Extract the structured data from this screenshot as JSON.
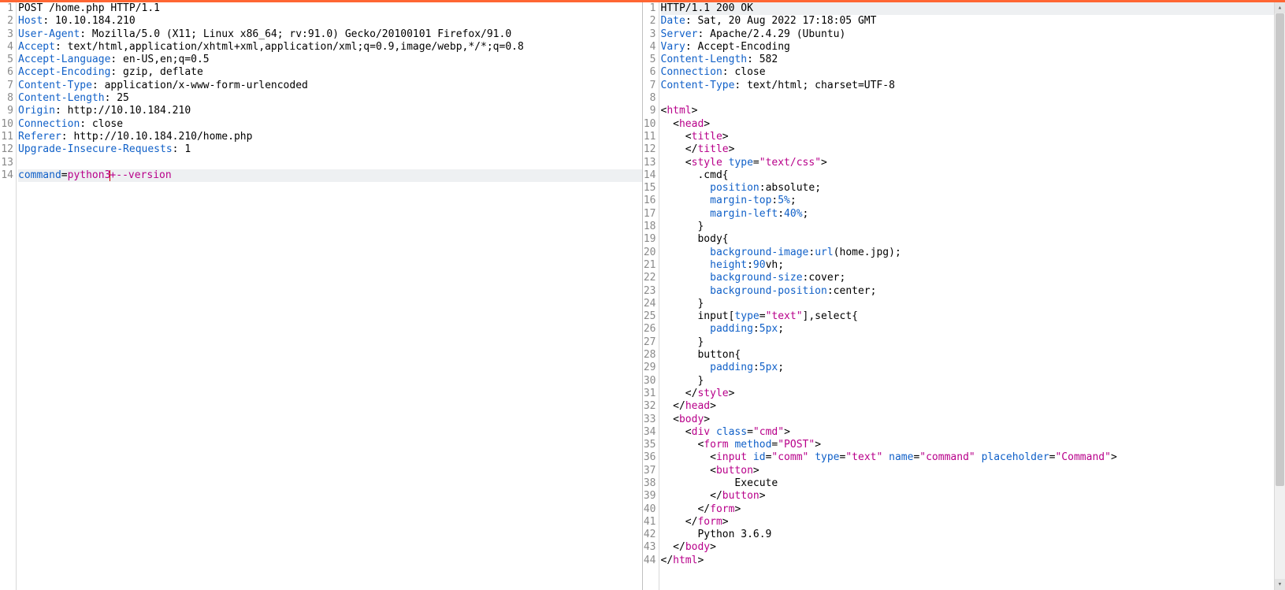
{
  "request": {
    "lines": [
      [
        {
          "t": "POST /home.php HTTP/1.1"
        }
      ],
      [
        {
          "t": "Host",
          "c": "hdr"
        },
        {
          "t": ": 10.10.184.210"
        }
      ],
      [
        {
          "t": "User-Agent",
          "c": "hdr"
        },
        {
          "t": ": Mozilla/5.0 (X11; Linux x86_64; rv:91.0) Gecko/20100101 Firefox/91.0"
        }
      ],
      [
        {
          "t": "Accept",
          "c": "hdr"
        },
        {
          "t": ": text/html,application/xhtml+xml,application/xml;q=0.9,image/webp,*/*;q=0.8"
        }
      ],
      [
        {
          "t": "Accept-Language",
          "c": "hdr"
        },
        {
          "t": ": en-US,en;q=0.5"
        }
      ],
      [
        {
          "t": "Accept-Encoding",
          "c": "hdr"
        },
        {
          "t": ": gzip, deflate"
        }
      ],
      [
        {
          "t": "Content-Type",
          "c": "hdr"
        },
        {
          "t": ": application/x-www-form-urlencoded"
        }
      ],
      [
        {
          "t": "Content-Length",
          "c": "hdr"
        },
        {
          "t": ": 25"
        }
      ],
      [
        {
          "t": "Origin",
          "c": "hdr"
        },
        {
          "t": ": http://10.10.184.210"
        }
      ],
      [
        {
          "t": "Connection",
          "c": "hdr"
        },
        {
          "t": ": close"
        }
      ],
      [
        {
          "t": "Referer",
          "c": "hdr"
        },
        {
          "t": ": http://10.10.184.210/home.php"
        }
      ],
      [
        {
          "t": "Upgrade-Insecure-Requests",
          "c": "hdr"
        },
        {
          "t": ": 1"
        }
      ],
      [
        {
          "t": ""
        }
      ],
      [
        {
          "t": "command",
          "c": "attr"
        },
        {
          "t": "="
        },
        {
          "t": "python3",
          "c": "val"
        },
        {
          "caret": true
        },
        {
          "t": "+--version",
          "c": "val"
        }
      ]
    ],
    "current_line": 14
  },
  "response": {
    "lines": [
      [
        {
          "t": "HTTP/1.1 200 OK"
        }
      ],
      [
        {
          "t": "Date",
          "c": "hdr"
        },
        {
          "t": ": Sat, 20 Aug 2022 17:18:05 GMT"
        }
      ],
      [
        {
          "t": "Server",
          "c": "hdr"
        },
        {
          "t": ": Apache/2.4.29 (Ubuntu)"
        }
      ],
      [
        {
          "t": "Vary",
          "c": "hdr"
        },
        {
          "t": ": Accept-Encoding"
        }
      ],
      [
        {
          "t": "Content-Length",
          "c": "hdr"
        },
        {
          "t": ": 582"
        }
      ],
      [
        {
          "t": "Connection",
          "c": "hdr"
        },
        {
          "t": ": close"
        }
      ],
      [
        {
          "t": "Content-Type",
          "c": "hdr"
        },
        {
          "t": ": text/html; charset=UTF-8"
        }
      ],
      [
        {
          "t": ""
        }
      ],
      [
        {
          "t": "<"
        },
        {
          "t": "html",
          "c": "tag"
        },
        {
          "t": ">"
        }
      ],
      [
        {
          "t": "  <"
        },
        {
          "t": "head",
          "c": "tag"
        },
        {
          "t": ">"
        }
      ],
      [
        {
          "t": "    <"
        },
        {
          "t": "title",
          "c": "tag"
        },
        {
          "t": ">"
        }
      ],
      [
        {
          "t": "    </"
        },
        {
          "t": "title",
          "c": "tag"
        },
        {
          "t": ">"
        }
      ],
      [
        {
          "t": "    <"
        },
        {
          "t": "style",
          "c": "tag"
        },
        {
          "t": " "
        },
        {
          "t": "type",
          "c": "attr"
        },
        {
          "t": "="
        },
        {
          "t": "\"text/css\"",
          "c": "val"
        },
        {
          "t": ">"
        }
      ],
      [
        {
          "t": "      .cmd{"
        }
      ],
      [
        {
          "t": "        "
        },
        {
          "t": "position",
          "c": "kw"
        },
        {
          "t": ":absolute;"
        }
      ],
      [
        {
          "t": "        "
        },
        {
          "t": "margin-top",
          "c": "kw"
        },
        {
          "t": ":"
        },
        {
          "t": "5%",
          "c": "num"
        },
        {
          "t": ";"
        }
      ],
      [
        {
          "t": "        "
        },
        {
          "t": "margin-left",
          "c": "kw"
        },
        {
          "t": ":"
        },
        {
          "t": "40%",
          "c": "num"
        },
        {
          "t": ";"
        }
      ],
      [
        {
          "t": "      }"
        }
      ],
      [
        {
          "t": "      body{"
        }
      ],
      [
        {
          "t": "        "
        },
        {
          "t": "background-image",
          "c": "kw"
        },
        {
          "t": ":"
        },
        {
          "t": "url",
          "c": "kw"
        },
        {
          "t": "(home.jpg);"
        }
      ],
      [
        {
          "t": "        "
        },
        {
          "t": "height",
          "c": "kw"
        },
        {
          "t": ":"
        },
        {
          "t": "90",
          "c": "num"
        },
        {
          "t": "vh;"
        }
      ],
      [
        {
          "t": "        "
        },
        {
          "t": "background-size",
          "c": "kw"
        },
        {
          "t": ":cover;"
        }
      ],
      [
        {
          "t": "        "
        },
        {
          "t": "background-position",
          "c": "kw"
        },
        {
          "t": ":center;"
        }
      ],
      [
        {
          "t": "      }"
        }
      ],
      [
        {
          "t": "      input["
        },
        {
          "t": "type",
          "c": "attr"
        },
        {
          "t": "="
        },
        {
          "t": "\"text\"",
          "c": "val"
        },
        {
          "t": "],select{"
        }
      ],
      [
        {
          "t": "        "
        },
        {
          "t": "padding",
          "c": "kw"
        },
        {
          "t": ":"
        },
        {
          "t": "5px",
          "c": "num"
        },
        {
          "t": ";"
        }
      ],
      [
        {
          "t": "      }"
        }
      ],
      [
        {
          "t": "      button{"
        }
      ],
      [
        {
          "t": "        "
        },
        {
          "t": "padding",
          "c": "kw"
        },
        {
          "t": ":"
        },
        {
          "t": "5px",
          "c": "num"
        },
        {
          "t": ";"
        }
      ],
      [
        {
          "t": "      }"
        }
      ],
      [
        {
          "t": "    </"
        },
        {
          "t": "style",
          "c": "tag"
        },
        {
          "t": ">"
        }
      ],
      [
        {
          "t": "  </"
        },
        {
          "t": "head",
          "c": "tag"
        },
        {
          "t": ">"
        }
      ],
      [
        {
          "t": "  <"
        },
        {
          "t": "body",
          "c": "tag"
        },
        {
          "t": ">"
        }
      ],
      [
        {
          "t": "    <"
        },
        {
          "t": "div",
          "c": "tag"
        },
        {
          "t": " "
        },
        {
          "t": "class",
          "c": "attr"
        },
        {
          "t": "="
        },
        {
          "t": "\"cmd\"",
          "c": "val"
        },
        {
          "t": ">"
        }
      ],
      [
        {
          "t": "      <"
        },
        {
          "t": "form",
          "c": "tag"
        },
        {
          "t": " "
        },
        {
          "t": "method",
          "c": "attr"
        },
        {
          "t": "="
        },
        {
          "t": "\"POST\"",
          "c": "val"
        },
        {
          "t": ">"
        }
      ],
      [
        {
          "t": "        <"
        },
        {
          "t": "input",
          "c": "tag"
        },
        {
          "t": " "
        },
        {
          "t": "id",
          "c": "attr"
        },
        {
          "t": "="
        },
        {
          "t": "\"comm\"",
          "c": "val"
        },
        {
          "t": " "
        },
        {
          "t": "type",
          "c": "attr"
        },
        {
          "t": "="
        },
        {
          "t": "\"text\"",
          "c": "val"
        },
        {
          "t": " "
        },
        {
          "t": "name",
          "c": "attr"
        },
        {
          "t": "="
        },
        {
          "t": "\"command\"",
          "c": "val"
        },
        {
          "t": " "
        },
        {
          "t": "placeholder",
          "c": "attr"
        },
        {
          "t": "="
        },
        {
          "t": "\"Command\"",
          "c": "val"
        },
        {
          "t": ">"
        }
      ],
      [
        {
          "t": "        <"
        },
        {
          "t": "button",
          "c": "tag"
        },
        {
          "t": ">"
        }
      ],
      [
        {
          "t": "            Execute"
        }
      ],
      [
        {
          "t": "        </"
        },
        {
          "t": "button",
          "c": "tag"
        },
        {
          "t": ">"
        }
      ],
      [
        {
          "t": "      </"
        },
        {
          "t": "form",
          "c": "tag"
        },
        {
          "t": ">"
        }
      ],
      [
        {
          "t": "    </"
        },
        {
          "t": "form",
          "c": "tag"
        },
        {
          "t": ">"
        }
      ],
      [
        {
          "t": "      Python 3.6.9"
        }
      ],
      [
        {
          "t": "  </"
        },
        {
          "t": "body",
          "c": "tag"
        },
        {
          "t": ">"
        }
      ],
      [
        {
          "t": "</"
        },
        {
          "t": "html",
          "c": "tag"
        },
        {
          "t": ">"
        }
      ]
    ],
    "status_bg_line": 1
  }
}
